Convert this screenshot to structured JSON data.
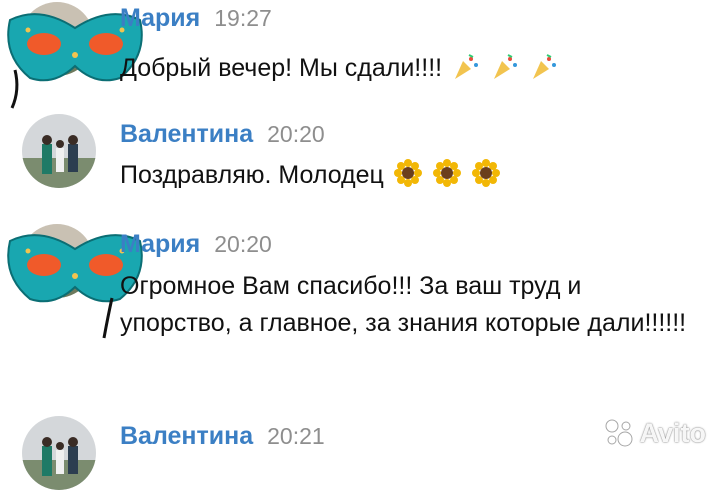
{
  "messages": [
    {
      "author": "Мария",
      "time": "19:27",
      "text": "Добрый вечер! Мы сдали!!!!",
      "emoji": "party-popper"
    },
    {
      "author": "Валентина",
      "time": "20:20",
      "text": "Поздравляю. Молодец",
      "emoji": "sunflower"
    },
    {
      "author": "Мария",
      "time": "20:20",
      "text": "Огромное Вам спасибо!!! За ваш труд и упорство, а главное, за знания которые дали!!!!!!"
    },
    {
      "author": "Валентина",
      "time": "20:21",
      "text": ""
    }
  ],
  "watermark": "Avito",
  "colors": {
    "name": "#3b7fc4",
    "time": "#8e8e8e",
    "text": "#111111",
    "mask_teal": "#19a7b0",
    "mask_orange": "#f05a2a"
  }
}
